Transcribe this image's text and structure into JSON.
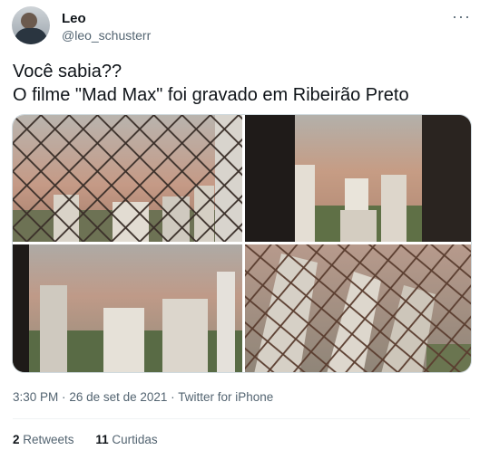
{
  "tweet": {
    "author_name": "Leo",
    "author_handle": "@leo_schusterr",
    "text_line1": "Você sabia??",
    "text_line2": "O filme \"Mad Max\" foi gravado em Ribeirão Preto",
    "time": "3:30 PM",
    "separator": "·",
    "date": "26 de set de 2021",
    "source": "Twitter for iPhone",
    "retweets_count": "2",
    "retweets_label": "Retweets",
    "likes_count": "11",
    "likes_label": "Curtidas",
    "more_icon": "more-horizontal-icon"
  },
  "colors": {
    "text_primary": "#0f1419",
    "text_secondary": "#536471",
    "dust_sky": "#c49a82",
    "divider": "#eff3f4"
  }
}
